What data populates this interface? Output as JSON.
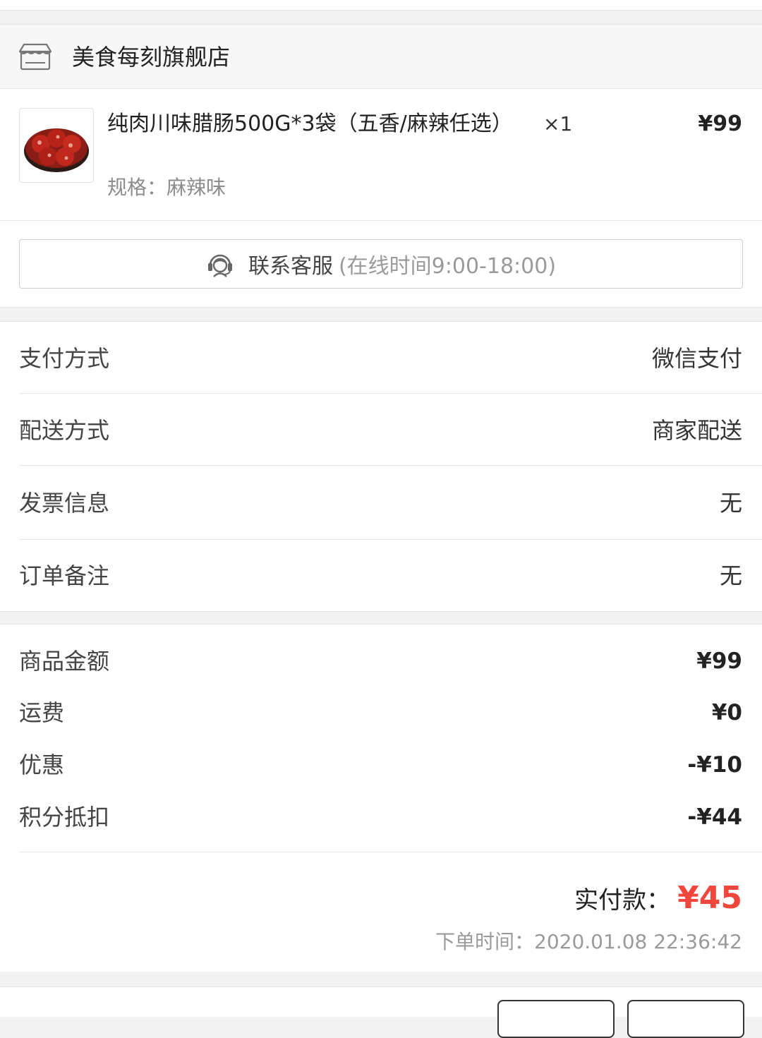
{
  "store": {
    "name": "美食每刻旗舰店",
    "icon": "store-icon"
  },
  "product": {
    "name": "纯肉川味腊肠500G*3袋（五香/麻辣任选）",
    "quantity": "×1",
    "price": "¥99",
    "spec": "规格：麻辣味"
  },
  "contact": {
    "label": "联系客服",
    "hours": "(在线时间9:00-18:00)",
    "icon": "customer-service-icon"
  },
  "info": {
    "payment": {
      "label": "支付方式",
      "value": "微信支付"
    },
    "delivery": {
      "label": "配送方式",
      "value": "商家配送"
    },
    "invoice": {
      "label": "发票信息",
      "value": "无"
    },
    "remark": {
      "label": "订单备注",
      "value": "无"
    }
  },
  "amounts": {
    "goods": {
      "label": "商品金额",
      "value": "¥99"
    },
    "shipping": {
      "label": "运费",
      "value": "¥0"
    },
    "discount": {
      "label": "优惠",
      "value": "-¥10"
    },
    "points": {
      "label": "积分抵扣",
      "value": "-¥44"
    },
    "total_label": "实付款：",
    "total_value": "¥45",
    "order_time": "下单时间：2020.01.08 22:36:42"
  },
  "colors": {
    "accent": "#f0463c",
    "background": "#f2f2f2"
  }
}
